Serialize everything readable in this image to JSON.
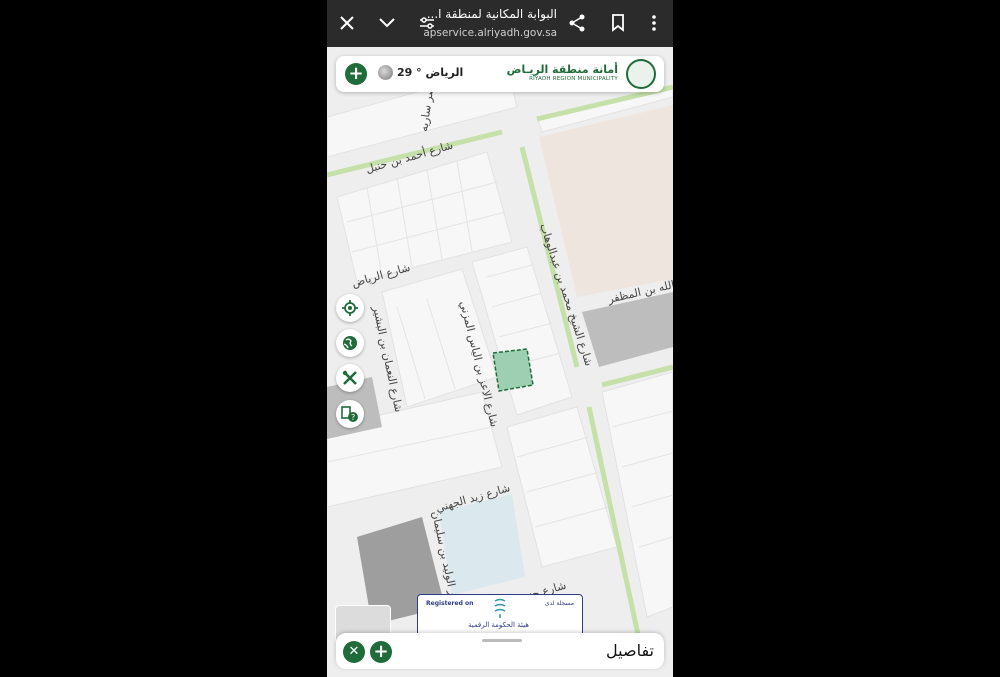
{
  "browser": {
    "page_title": "البوابة المكانية لمنطقة ا...",
    "url": "apservice.alriyadh.gov.sa"
  },
  "header": {
    "weather_text": "الرياض ° 29",
    "logo_arabic": "أمانة منطقة الريـاض",
    "logo_english": "RIYADH REGION MUNICIPALITY"
  },
  "streets": {
    "s1": "مصر ساريه",
    "s2": "شارع أحمد بن حنبل",
    "s3": "شارع الرياض",
    "s4": "شارع الشيخ محمد بن عبدالوهاب",
    "s5": "عبد الله بن المظفر",
    "s6": "شارع النعمان بن البشير",
    "s7": "شارع الاعز بن الياس المزني",
    "s8": "شارع زيد الجهني",
    "s9": "ممر الوليد بن سليمان",
    "s10": "شارع حنين"
  },
  "badge": {
    "registered_on": "Registered on",
    "registered_ar": "مسجلة لدى",
    "authority": "هيئة الحكومة الرقمية"
  },
  "bottom_sheet": {
    "title": "تفاصيل"
  },
  "colors": {
    "brand_green": "#1f6b3a",
    "selected_parcel": "#9ecfb3",
    "green_street": "#c5e0a8"
  }
}
